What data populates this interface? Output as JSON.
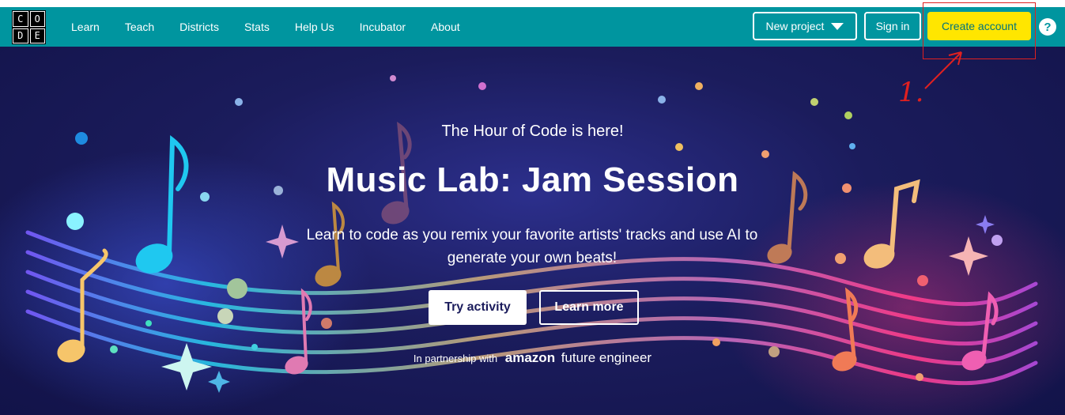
{
  "logo": {
    "letters": [
      "C",
      "O",
      "D",
      "E"
    ]
  },
  "nav": {
    "links": [
      "Learn",
      "Teach",
      "Districts",
      "Stats",
      "Help Us",
      "Incubator",
      "About"
    ],
    "new_project_label": "New project",
    "sign_in_label": "Sign in",
    "create_account_label": "Create account",
    "help_label": "?"
  },
  "annotation": {
    "step_label": "1."
  },
  "hero": {
    "eyebrow": "The Hour of Code is here!",
    "title": "Music Lab: Jam Session",
    "subtitle": "Learn to code as you remix your favorite artists' tracks and use AI to generate your own beats!",
    "try_button": "Try activity",
    "learn_button": "Learn more",
    "partnership_prefix": "In partnership with",
    "partner_brand": "amazon",
    "partner_brand_suffix": "future engineer"
  },
  "colors": {
    "nav_bg": "#00959f",
    "hero_bg": "#1b1c5c",
    "create_bg": "#ffe600",
    "annotation": "#e02020"
  }
}
